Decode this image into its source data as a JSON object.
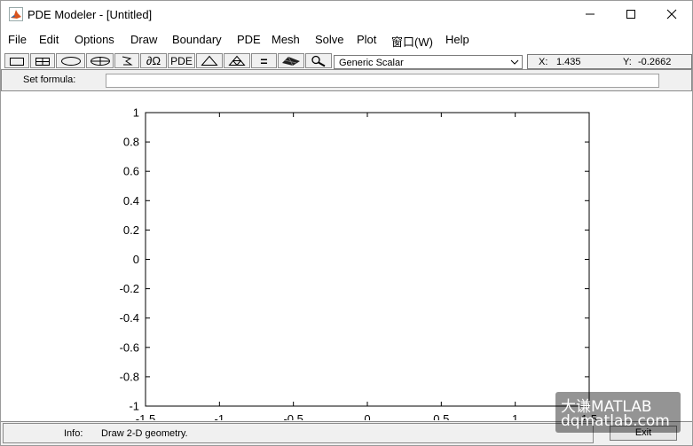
{
  "window": {
    "title": "PDE Modeler - [Untitled]",
    "minimize_icon": "minimize-icon",
    "maximize_icon": "maximize-icon",
    "close_icon": "close-icon"
  },
  "menu": [
    "File",
    "Edit",
    "Options",
    "Draw",
    "Boundary",
    "PDE",
    "Mesh",
    "Solve",
    "Plot",
    "窗口(W)",
    "Help"
  ],
  "toolbar": {
    "buttons": [
      {
        "icon": "rectangle-icon"
      },
      {
        "icon": "rectangle-centered-icon"
      },
      {
        "icon": "ellipse-icon"
      },
      {
        "icon": "ellipse-centered-icon"
      },
      {
        "icon": "polygon-icon"
      },
      {
        "icon": "boundary-mode-icon",
        "text": "∂Ω"
      },
      {
        "icon": "pde-spec-button",
        "text": "PDE"
      },
      {
        "icon": "init-mesh-icon"
      },
      {
        "icon": "refine-mesh-icon"
      },
      {
        "icon": "solve-icon",
        "text": "="
      },
      {
        "icon": "plot-icon"
      },
      {
        "icon": "zoom-icon"
      }
    ],
    "application_mode": "Generic Scalar",
    "coords": {
      "x_label": "X:",
      "x_value": "1.435",
      "y_label": "Y:",
      "y_value": "-0.2662"
    }
  },
  "formula": {
    "label": "Set formula:",
    "value": ""
  },
  "axes": {
    "xlim": [
      -1.5,
      1.5
    ],
    "ylim": [
      -1,
      1
    ],
    "xticks": [
      "-1.5",
      "-1",
      "-0.5",
      "0",
      "0.5",
      "1",
      "1.5"
    ],
    "yticks": [
      "1",
      "0.8",
      "0.6",
      "0.4",
      "0.2",
      "0",
      "-0.2",
      "-0.4",
      "-0.6",
      "-0.8",
      "-1"
    ],
    "grid": false
  },
  "status": {
    "info_label": "Info:",
    "info_text": "Draw 2-D geometry.",
    "exit_label": "Exit"
  },
  "watermark": {
    "line1": "大谦MATLAB",
    "line2": "dqmatlab.com"
  }
}
